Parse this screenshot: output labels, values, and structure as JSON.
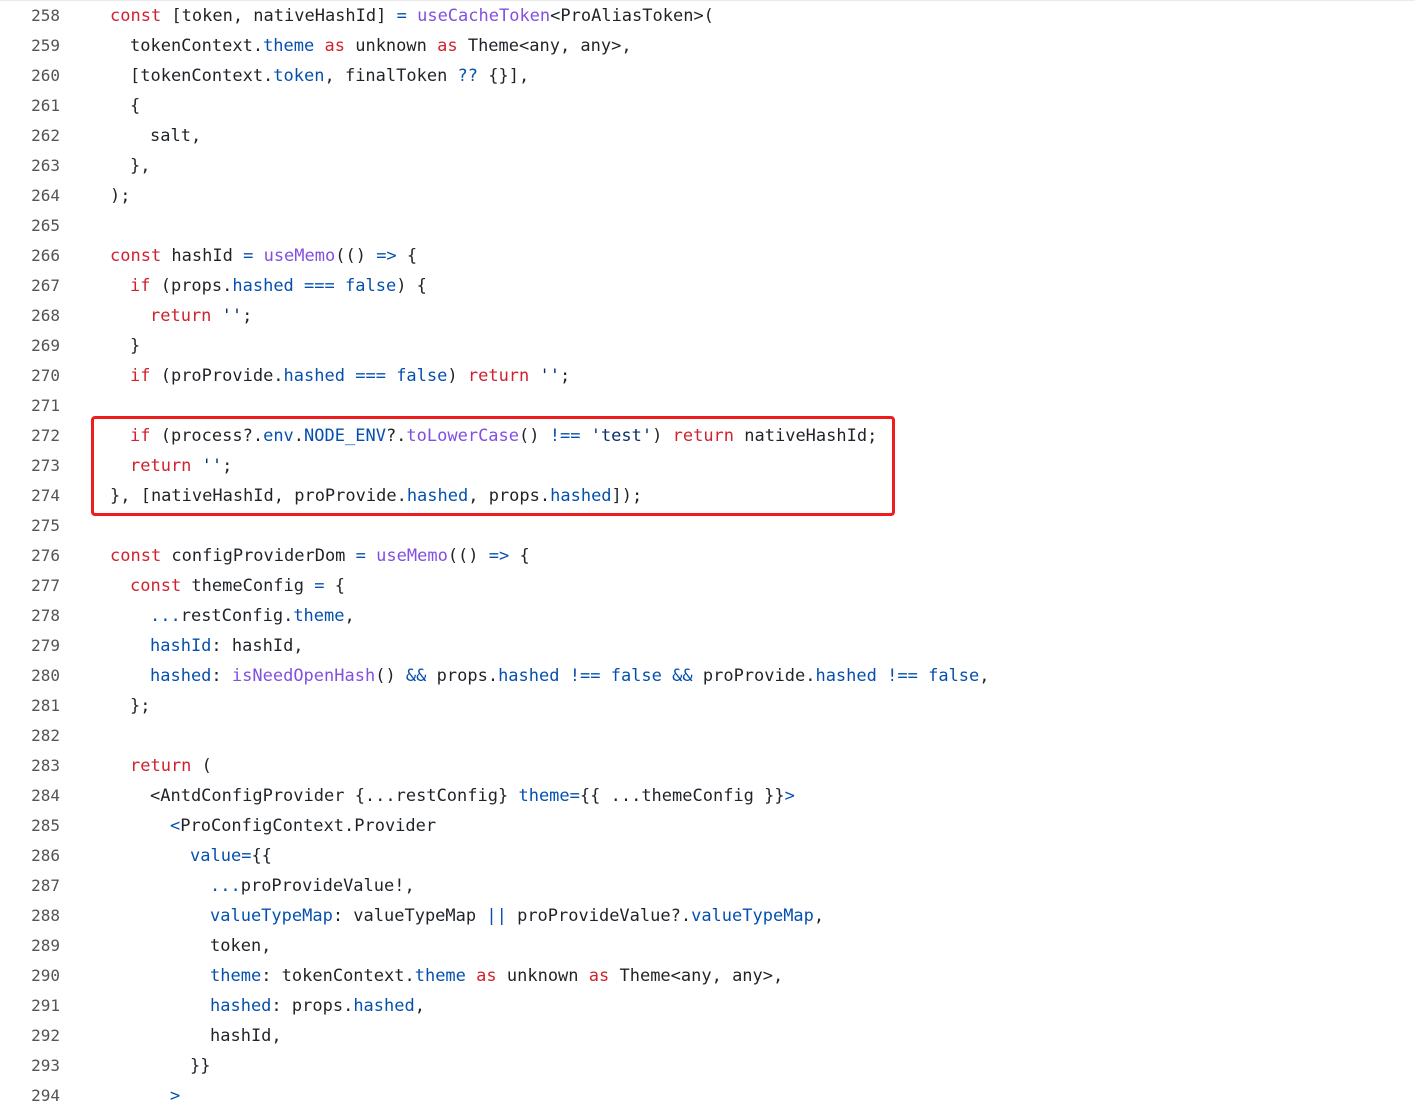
{
  "code_view": {
    "lines": [
      {
        "number": "258",
        "indent": 0,
        "tokens": [
          [
            "kw",
            "const"
          ],
          [
            "plain",
            " [token, nativeHashId] "
          ],
          [
            "op",
            "="
          ],
          [
            "plain",
            " "
          ],
          [
            "fn",
            "useCacheToken"
          ],
          [
            "plain",
            "<ProAliasToken>("
          ]
        ]
      },
      {
        "number": "259",
        "indent": 1,
        "tokens": [
          [
            "plain",
            "tokenContext."
          ],
          [
            "prop",
            "theme"
          ],
          [
            "plain",
            " "
          ],
          [
            "kw",
            "as"
          ],
          [
            "plain",
            " unknown "
          ],
          [
            "kw",
            "as"
          ],
          [
            "plain",
            " Theme<any, any>,"
          ]
        ]
      },
      {
        "number": "260",
        "indent": 1,
        "tokens": [
          [
            "plain",
            "[tokenContext."
          ],
          [
            "prop",
            "token"
          ],
          [
            "plain",
            ", finalToken "
          ],
          [
            "op",
            "??"
          ],
          [
            "plain",
            " {}],"
          ]
        ]
      },
      {
        "number": "261",
        "indent": 1,
        "tokens": [
          [
            "plain",
            "{"
          ]
        ]
      },
      {
        "number": "262",
        "indent": 2,
        "tokens": [
          [
            "plain",
            "salt,"
          ]
        ]
      },
      {
        "number": "263",
        "indent": 1,
        "tokens": [
          [
            "plain",
            "},"
          ]
        ]
      },
      {
        "number": "264",
        "indent": 0,
        "tokens": [
          [
            "plain",
            ");"
          ]
        ]
      },
      {
        "number": "265",
        "indent": 0,
        "tokens": []
      },
      {
        "number": "266",
        "indent": 0,
        "tokens": [
          [
            "kw",
            "const"
          ],
          [
            "plain",
            " hashId "
          ],
          [
            "op",
            "="
          ],
          [
            "plain",
            " "
          ],
          [
            "fn",
            "useMemo"
          ],
          [
            "plain",
            "(() "
          ],
          [
            "op",
            "=>"
          ],
          [
            "plain",
            " {"
          ]
        ]
      },
      {
        "number": "267",
        "indent": 1,
        "tokens": [
          [
            "kw",
            "if"
          ],
          [
            "plain",
            " (props."
          ],
          [
            "prop",
            "hashed"
          ],
          [
            "plain",
            " "
          ],
          [
            "op",
            "==="
          ],
          [
            "plain",
            " "
          ],
          [
            "prop",
            "false"
          ],
          [
            "plain",
            ") {"
          ]
        ]
      },
      {
        "number": "268",
        "indent": 2,
        "tokens": [
          [
            "kw",
            "return"
          ],
          [
            "plain",
            " "
          ],
          [
            "str",
            "''"
          ],
          [
            "plain",
            ";"
          ]
        ]
      },
      {
        "number": "269",
        "indent": 1,
        "tokens": [
          [
            "plain",
            "}"
          ]
        ]
      },
      {
        "number": "270",
        "indent": 1,
        "tokens": [
          [
            "kw",
            "if"
          ],
          [
            "plain",
            " (proProvide."
          ],
          [
            "prop",
            "hashed"
          ],
          [
            "plain",
            " "
          ],
          [
            "op",
            "==="
          ],
          [
            "plain",
            " "
          ],
          [
            "prop",
            "false"
          ],
          [
            "plain",
            ") "
          ],
          [
            "kw",
            "return"
          ],
          [
            "plain",
            " "
          ],
          [
            "str",
            "''"
          ],
          [
            "plain",
            ";"
          ]
        ]
      },
      {
        "number": "271",
        "indent": 0,
        "tokens": []
      },
      {
        "number": "272",
        "indent": 1,
        "tokens": [
          [
            "kw",
            "if"
          ],
          [
            "plain",
            " (process?."
          ],
          [
            "prop",
            "env"
          ],
          [
            "plain",
            "."
          ],
          [
            "prop",
            "NODE_ENV"
          ],
          [
            "plain",
            "?."
          ],
          [
            "fn",
            "toLowerCase"
          ],
          [
            "plain",
            "() "
          ],
          [
            "op",
            "!=="
          ],
          [
            "plain",
            " "
          ],
          [
            "str",
            "'test'"
          ],
          [
            "plain",
            ") "
          ],
          [
            "kw",
            "return"
          ],
          [
            "plain",
            " nativeHashId;"
          ]
        ]
      },
      {
        "number": "273",
        "indent": 1,
        "tokens": [
          [
            "kw",
            "return"
          ],
          [
            "plain",
            " "
          ],
          [
            "str",
            "''"
          ],
          [
            "plain",
            ";"
          ]
        ]
      },
      {
        "number": "274",
        "indent": 0,
        "tokens": [
          [
            "plain",
            "}, [nativeHashId, proProvide."
          ],
          [
            "prop",
            "hashed"
          ],
          [
            "plain",
            ", props."
          ],
          [
            "prop",
            "hashed"
          ],
          [
            "plain",
            "]);"
          ]
        ]
      },
      {
        "number": "275",
        "indent": 0,
        "tokens": []
      },
      {
        "number": "276",
        "indent": 0,
        "tokens": [
          [
            "kw",
            "const"
          ],
          [
            "plain",
            " configProviderDom "
          ],
          [
            "op",
            "="
          ],
          [
            "plain",
            " "
          ],
          [
            "fn",
            "useMemo"
          ],
          [
            "plain",
            "(() "
          ],
          [
            "op",
            "=>"
          ],
          [
            "plain",
            " {"
          ]
        ]
      },
      {
        "number": "277",
        "indent": 1,
        "tokens": [
          [
            "kw",
            "const"
          ],
          [
            "plain",
            " themeConfig "
          ],
          [
            "op",
            "="
          ],
          [
            "plain",
            " {"
          ]
        ]
      },
      {
        "number": "278",
        "indent": 2,
        "tokens": [
          [
            "op",
            "..."
          ],
          [
            "plain",
            "restConfig."
          ],
          [
            "prop",
            "theme"
          ],
          [
            "plain",
            ","
          ]
        ]
      },
      {
        "number": "279",
        "indent": 2,
        "tokens": [
          [
            "prop",
            "hashId"
          ],
          [
            "plain",
            ": hashId,"
          ]
        ]
      },
      {
        "number": "280",
        "indent": 2,
        "tokens": [
          [
            "prop",
            "hashed"
          ],
          [
            "plain",
            ": "
          ],
          [
            "fn",
            "isNeedOpenHash"
          ],
          [
            "plain",
            "() "
          ],
          [
            "op",
            "&&"
          ],
          [
            "plain",
            " props."
          ],
          [
            "prop",
            "hashed"
          ],
          [
            "plain",
            " "
          ],
          [
            "op",
            "!=="
          ],
          [
            "plain",
            " "
          ],
          [
            "prop",
            "false"
          ],
          [
            "plain",
            " "
          ],
          [
            "op",
            "&&"
          ],
          [
            "plain",
            " proProvide."
          ],
          [
            "prop",
            "hashed"
          ],
          [
            "plain",
            " "
          ],
          [
            "op",
            "!=="
          ],
          [
            "plain",
            " "
          ],
          [
            "prop",
            "false"
          ],
          [
            "plain",
            ","
          ]
        ]
      },
      {
        "number": "281",
        "indent": 1,
        "tokens": [
          [
            "plain",
            "};"
          ]
        ]
      },
      {
        "number": "282",
        "indent": 0,
        "tokens": []
      },
      {
        "number": "283",
        "indent": 1,
        "tokens": [
          [
            "kw",
            "return"
          ],
          [
            "plain",
            " ("
          ]
        ]
      },
      {
        "number": "284",
        "indent": 2,
        "tokens": [
          [
            "plain",
            "<AntdConfigProvider {...restConfig} "
          ],
          [
            "prop",
            "theme"
          ],
          [
            "op",
            "="
          ],
          [
            "plain",
            "{{ ...themeConfig }}"
          ],
          [
            "op",
            ">"
          ]
        ]
      },
      {
        "number": "285",
        "indent": 3,
        "tokens": [
          [
            "op",
            "<"
          ],
          [
            "plain",
            "ProConfigContext.Provider"
          ]
        ]
      },
      {
        "number": "286",
        "indent": 4,
        "tokens": [
          [
            "prop",
            "value"
          ],
          [
            "op",
            "="
          ],
          [
            "plain",
            "{{"
          ]
        ]
      },
      {
        "number": "287",
        "indent": 5,
        "tokens": [
          [
            "op",
            "..."
          ],
          [
            "plain",
            "proProvideValue!,"
          ]
        ]
      },
      {
        "number": "288",
        "indent": 5,
        "tokens": [
          [
            "prop",
            "valueTypeMap"
          ],
          [
            "plain",
            ": valueTypeMap "
          ],
          [
            "op",
            "||"
          ],
          [
            "plain",
            " proProvideValue?."
          ],
          [
            "prop",
            "valueTypeMap"
          ],
          [
            "plain",
            ","
          ]
        ]
      },
      {
        "number": "289",
        "indent": 5,
        "tokens": [
          [
            "plain",
            "token,"
          ]
        ]
      },
      {
        "number": "290",
        "indent": 5,
        "tokens": [
          [
            "prop",
            "theme"
          ],
          [
            "plain",
            ": tokenContext."
          ],
          [
            "prop",
            "theme"
          ],
          [
            "plain",
            " "
          ],
          [
            "kw",
            "as"
          ],
          [
            "plain",
            " unknown "
          ],
          [
            "kw",
            "as"
          ],
          [
            "plain",
            " Theme<any, any>,"
          ]
        ]
      },
      {
        "number": "291",
        "indent": 5,
        "tokens": [
          [
            "prop",
            "hashed"
          ],
          [
            "plain",
            ": props."
          ],
          [
            "prop",
            "hashed"
          ],
          [
            "plain",
            ","
          ]
        ]
      },
      {
        "number": "292",
        "indent": 5,
        "tokens": [
          [
            "plain",
            "hashId,"
          ]
        ]
      },
      {
        "number": "293",
        "indent": 4,
        "tokens": [
          [
            "plain",
            "}}"
          ]
        ]
      },
      {
        "number": "294",
        "indent": 3,
        "tokens": [
          [
            "op",
            ">"
          ]
        ]
      }
    ]
  },
  "highlight": {
    "color": "#ee1c1c",
    "lines": [
      "272",
      "273",
      "274"
    ]
  },
  "colors": {
    "keyword": "#cf222e",
    "function": "#8250df",
    "property": "#0550ae",
    "string": "#0a3069",
    "text": "#1f2328",
    "line_number": "#545454"
  }
}
